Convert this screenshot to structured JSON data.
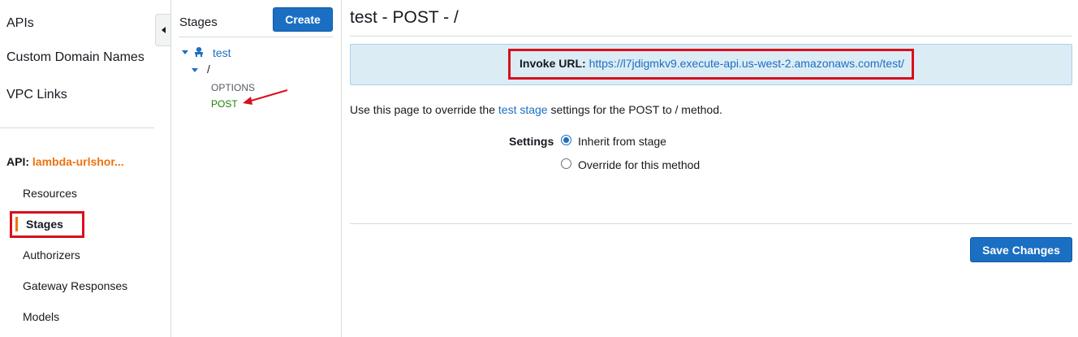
{
  "leftnav": {
    "top_items": [
      "APIs",
      "Custom Domain Names",
      "VPC Links"
    ],
    "api_prefix": "API:",
    "api_name": "lambda-urlshor...",
    "sub_items": [
      "Resources",
      "Stages",
      "Authorizers",
      "Gateway Responses",
      "Models"
    ],
    "active_item": "Stages"
  },
  "stages_panel": {
    "title": "Stages",
    "create_label": "Create",
    "tree": {
      "stage": "test",
      "resource": "/",
      "methods": [
        "OPTIONS",
        "POST"
      ],
      "selected_method": "POST"
    }
  },
  "main": {
    "title": "test - POST - /",
    "invoke_label": "Invoke URL:",
    "invoke_url": "https://l7jdigmkv9.execute-api.us-west-2.amazonaws.com/test/",
    "desc_prefix": "Use this page to override the ",
    "desc_link": "test stage",
    "desc_suffix": " settings for the POST to / method.",
    "settings_label": "Settings",
    "options": [
      {
        "label": "Inherit from stage",
        "checked": true
      },
      {
        "label": "Override for this method",
        "checked": false
      }
    ],
    "save_label": "Save Changes"
  },
  "colors": {
    "accent_blue": "#1a6fc3",
    "accent_orange": "#ec7211",
    "annotation_red": "#d80f1d",
    "info_bg": "#dcecf5",
    "selected_green": "#1d8102"
  }
}
